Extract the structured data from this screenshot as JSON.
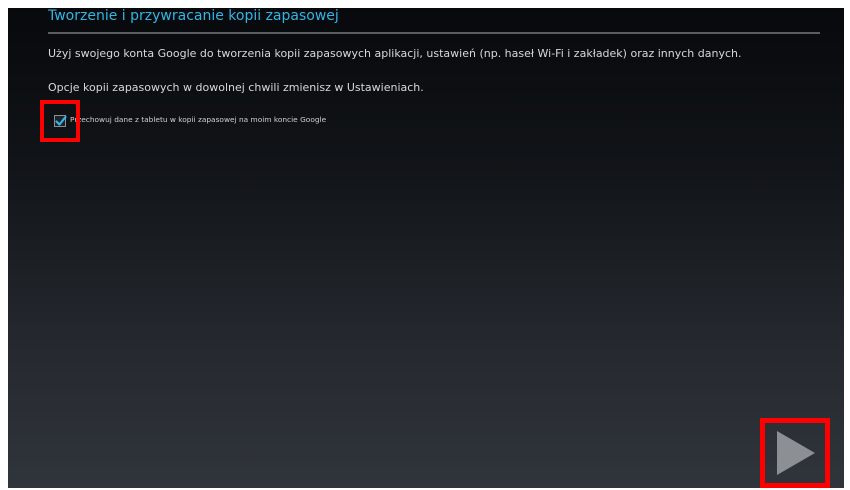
{
  "setup_screen": {
    "title": "Tworzenie i przywracanie kopii zapasowej",
    "description": "Użyj swojego konta Google do tworzenia kopii zapasowych aplikacji, ustawień (np. haseł Wi-Fi i zakładek) oraz innych danych.",
    "options_note": "Opcje kopii zapasowych w dowolnej chwili zmienisz w Ustawieniach.",
    "backup_checkbox": {
      "label": "Przechowuj dane z tabletu w kopii zapasowej na moim koncie Google",
      "checked": true
    },
    "next_button": {
      "icon": "play-arrow-icon"
    }
  },
  "colors": {
    "title_accent": "#33b5e5",
    "highlight": "#ff0000",
    "next_arrow": "#8c8f93"
  }
}
